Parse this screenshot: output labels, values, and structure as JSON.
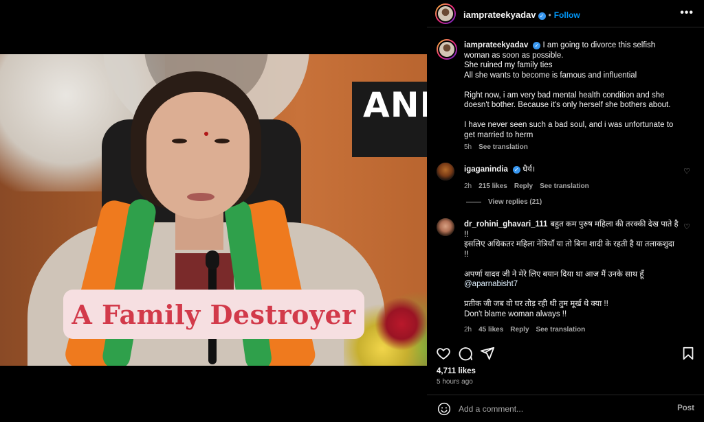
{
  "media": {
    "overlay_text": "A Family Destroyer",
    "background_sign_text": "ANI"
  },
  "header": {
    "username": "iamprateekyadav",
    "separator": "•",
    "follow_label": "Follow",
    "more_label": "•••"
  },
  "caption": {
    "username": "iamprateekyadav",
    "text": "I am going to divorce this selfish woman as soon as possible.\nShe ruined my family ties\nAll she wants to become is famous and influential\n\nRight now, i am very bad mental health condition and she doesn't bother. Because it's only herself she bothers about.\n\nI have never seen such a bad soul, and i was unfortunate to get married to herm",
    "time": "5h",
    "see_translation": "See translation"
  },
  "comments": [
    {
      "username": "igaganindia",
      "verified": true,
      "text": "धैर्य।",
      "time": "2h",
      "likes": "215 likes",
      "reply": "Reply",
      "see_translation": "See translation"
    },
    {
      "username": "dr_rohini_ghavari_111",
      "verified": false,
      "text_part1": "बहुत कम पुरुष महिला की तरक्की देख पाते है !!\nइसलिए अधिकतर महिला नेत्रियाँ या तो बिना शादी के रहती है या तलाकशुदा !!\n\nअपर्णा यादव जी ने मेरे लिए बयान दिया था आज मैं उनके साथ हूँ",
      "mention": "@aparnabisht7",
      "text_part2": "प्रतीक जी जब वो घर तोड़ रही थी तुम मूर्ख थे क्या !!\nDon't blame woman always !!",
      "time": "2h",
      "likes": "45 likes",
      "reply": "Reply",
      "see_translation": "See translation"
    }
  ],
  "view_replies": "View replies (21)",
  "likes_count": "4,711 likes",
  "posted_ago": "5 hours ago",
  "add_comment": {
    "placeholder": "Add a comment...",
    "post_label": "Post"
  },
  "icons": {
    "like": "heart-icon",
    "comment": "comment-bubble-icon",
    "share": "send-icon",
    "save": "bookmark-icon",
    "emoji": "emoji-icon"
  },
  "colors": {
    "accent_blue": "#0095f6",
    "verified_blue": "#3897f0",
    "muted_text": "#a8a8a8",
    "caption_overlay_bg": "#f6dfe1",
    "caption_overlay_text": "#d23a4a"
  }
}
